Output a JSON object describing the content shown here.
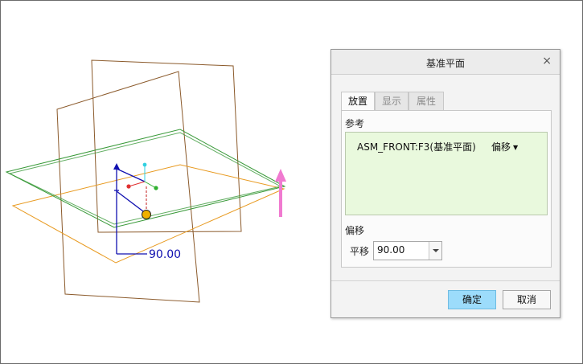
{
  "viewport": {
    "dimension_value": "90.00",
    "colors": {
      "datum_plane": "#8b5a2b",
      "assembly_plane": "#e89a20",
      "new_plane": "#3a9a3a",
      "dimension": "#1010b0",
      "drag_arrow": "#f07ad0",
      "handle": "#f0b000"
    }
  },
  "dialog": {
    "title": "基准平面",
    "close_glyph": "×",
    "tabs": [
      {
        "label": "放置",
        "active": true
      },
      {
        "label": "显示",
        "active": false
      },
      {
        "label": "属性",
        "active": false
      }
    ],
    "references": {
      "label": "参考",
      "item_name": "ASM_FRONT:F3(基准平面)",
      "constraint": "偏移",
      "constraint_caret": "▼"
    },
    "offset": {
      "section_label": "偏移",
      "field_label": "平移",
      "value": "90.00"
    },
    "buttons": {
      "ok": "确定",
      "cancel": "取消"
    }
  }
}
